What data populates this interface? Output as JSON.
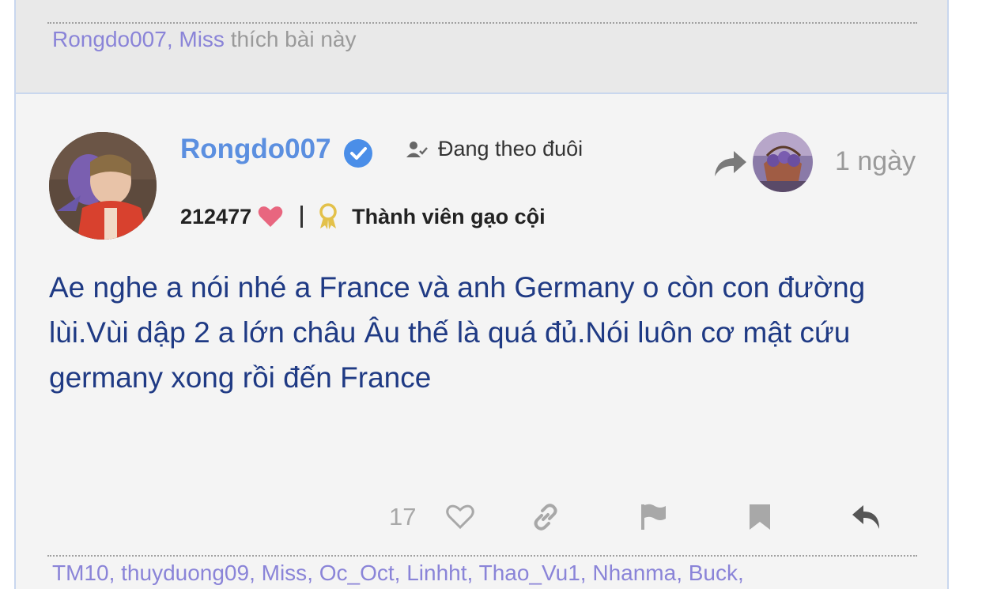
{
  "previous_post": {
    "likers": [
      "Rongdo007",
      "Miss"
    ],
    "like_suffix": "thích bài này"
  },
  "post": {
    "author": "Rongdo007",
    "verified": true,
    "follow_label": "Đang theo đuôi",
    "time": "1 ngày",
    "reputation": "212477",
    "rank": "Thành viên gạo cội",
    "body": "Ae nghe a nói nhé a France và anh Germany o còn con đường lùi.Vùi dập 2 a lớn châu Âu thế là quá đủ.Nói luôn cơ mật cứu germany xong rồi đến France",
    "like_count": "17",
    "likers": [
      "TM10",
      "thuyduong09",
      "Miss",
      "Oc_Oct",
      "Linhht",
      "Thao_Vu1",
      "Nhanma",
      "Buck"
    ]
  },
  "icons": {
    "verified": "verified-check-icon",
    "follow": "user-check-icon",
    "share": "share-arrow-icon",
    "heart": "heart-icon",
    "rank": "award-ribbon-icon",
    "like": "heart-outline-icon",
    "link": "link-icon",
    "report": "flag-icon",
    "bookmark": "bookmark-icon",
    "reply": "reply-icon"
  },
  "colors": {
    "username": "#5b8fe0",
    "body_text": "#1f3a84",
    "liker_link": "#8a84d8",
    "heart": "#e8667f",
    "verified": "#4a8ee8"
  }
}
